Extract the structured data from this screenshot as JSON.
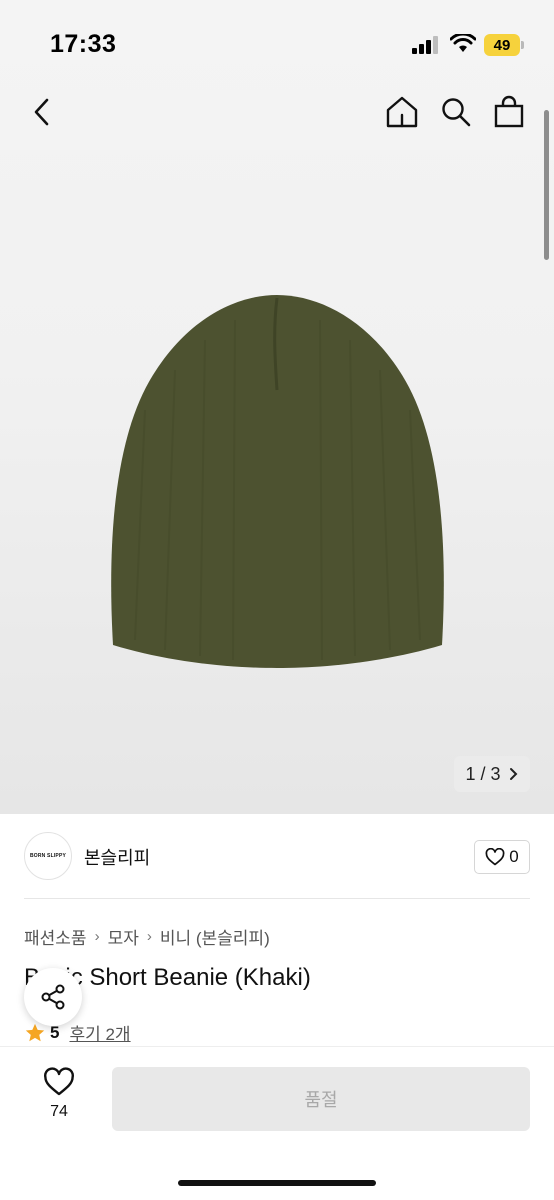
{
  "status_bar": {
    "time": "17:33",
    "battery_level": "49"
  },
  "navigation": {
    "back_icon": "chevron-left-icon",
    "home_icon": "home-icon",
    "search_icon": "search-icon",
    "bag_icon": "shopping-bag-icon"
  },
  "gallery": {
    "current": "1",
    "total": "3",
    "separator": "/"
  },
  "brand": {
    "logo_text": "BORN SLIPPY",
    "name": "본슬리피",
    "like_count": "0"
  },
  "breadcrumb": [
    {
      "label": "패션소품"
    },
    {
      "label": "모자"
    },
    {
      "label": "비니 (본슬리피)"
    }
  ],
  "product": {
    "title": "Basic Short Beanie (Khaki)"
  },
  "rating": {
    "score": "5",
    "review_label": "후기 2개"
  },
  "bottom": {
    "wish_count": "74",
    "action_label": "품절"
  },
  "colors": {
    "accent_star": "#f5a623",
    "product_khaki": "#4d5230",
    "battery": "#f6d23c"
  }
}
